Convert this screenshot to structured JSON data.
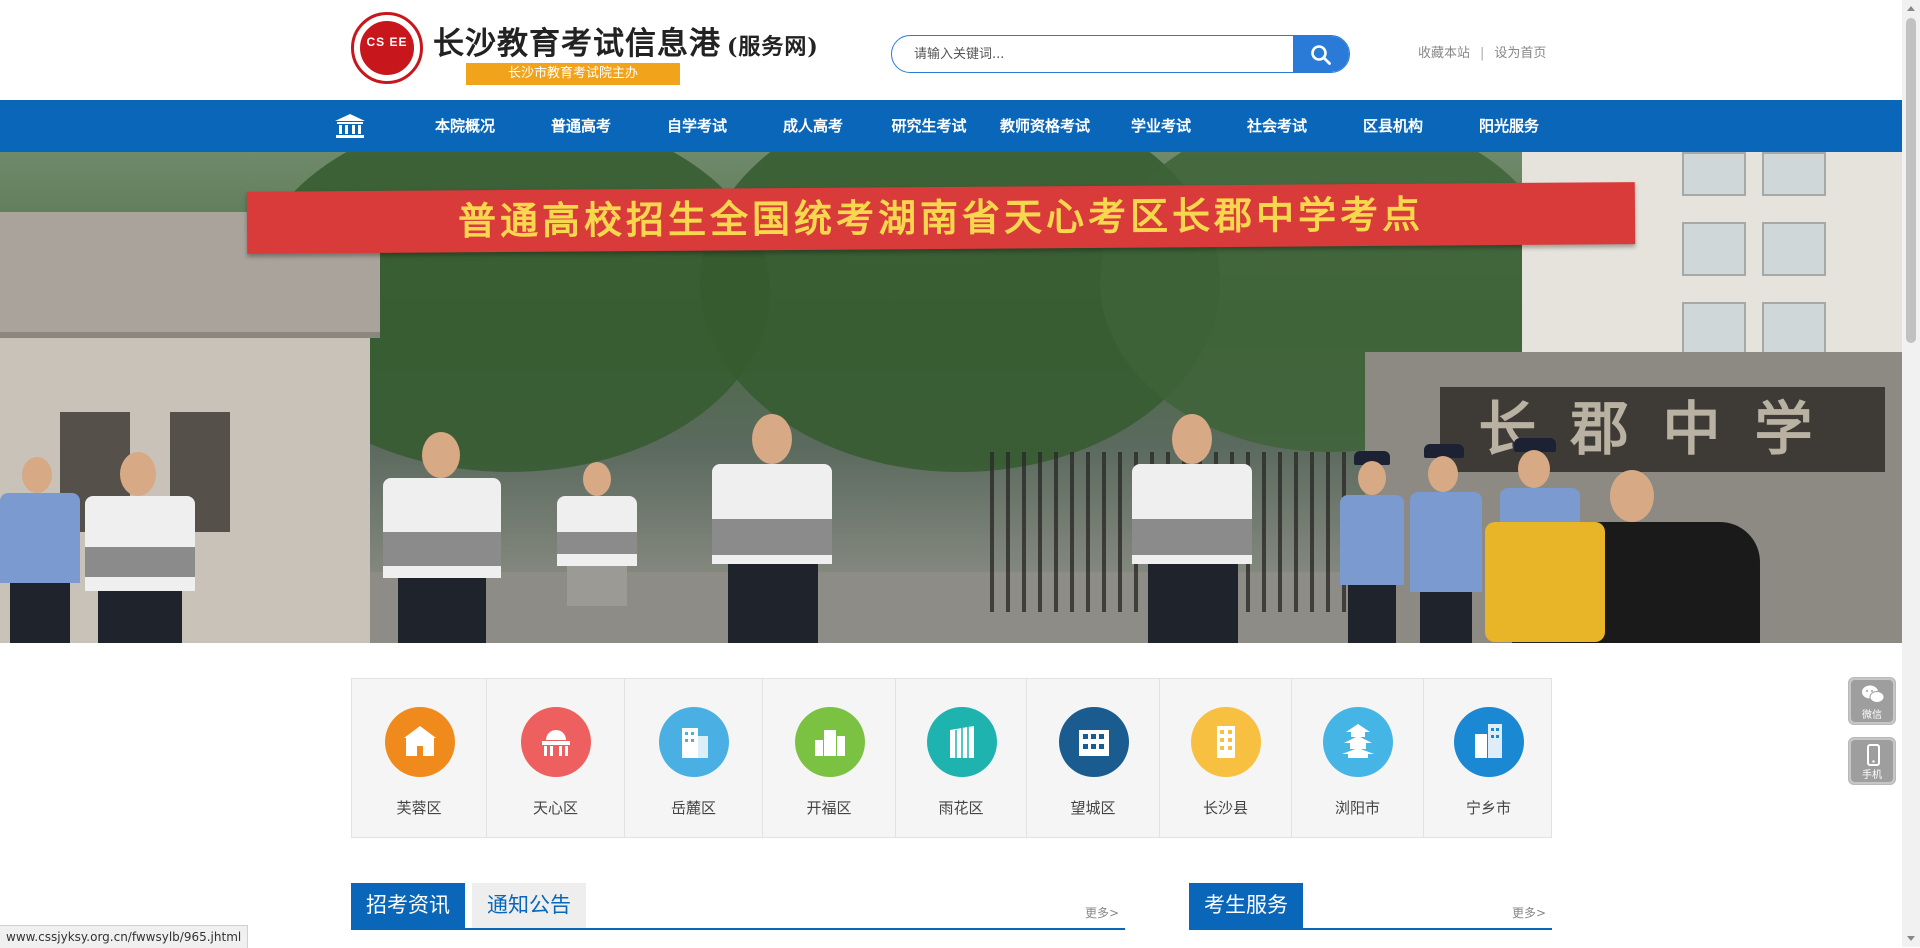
{
  "header": {
    "logo_monogram": "CS EE",
    "site_title": "长沙教育考试信息港",
    "site_title_suffix": "(服务网)",
    "sponsor": "长沙市教育考试院主办",
    "search": {
      "placeholder": "请输入关键词..."
    },
    "links": {
      "favorite": "收藏本站",
      "separator": "|",
      "homepage": "设为首页"
    }
  },
  "nav": {
    "items": [
      {
        "label": "本院概况"
      },
      {
        "label": "普通高考"
      },
      {
        "label": "自学考试"
      },
      {
        "label": "成人高考"
      },
      {
        "label": "研究生考试"
      },
      {
        "label": "教师资格考试"
      },
      {
        "label": "学业考试"
      },
      {
        "label": "社会考试"
      },
      {
        "label": "区县机构"
      },
      {
        "label": "阳光服务"
      }
    ]
  },
  "banner": {
    "banner_text": "普通高校招生全国统考湖南省天心考区长郡中学考点",
    "plaque_text": "长郡中学",
    "slide_count": 6,
    "active_slide": 5
  },
  "districts": [
    {
      "label": "芙蓉区",
      "color": "#f08a1c",
      "icon": "school-building-icon"
    },
    {
      "label": "天心区",
      "color": "#ee5f5f",
      "icon": "capitol-building-icon"
    },
    {
      "label": "岳麓区",
      "color": "#4ab0e4",
      "icon": "office-building-icon"
    },
    {
      "label": "开福区",
      "color": "#7cc242",
      "icon": "city-skyline-icon"
    },
    {
      "label": "雨花区",
      "color": "#1fb3b0",
      "icon": "glass-tower-icon"
    },
    {
      "label": "望城区",
      "color": "#1a5c8f",
      "icon": "apartment-block-icon"
    },
    {
      "label": "长沙县",
      "color": "#f8c040",
      "icon": "tower-building-icon"
    },
    {
      "label": "浏阳市",
      "color": "#45b5e6",
      "icon": "pagoda-icon"
    },
    {
      "label": "宁乡市",
      "color": "#1b88d3",
      "icon": "highrise-icon"
    }
  ],
  "news": {
    "tabs": [
      "招考资讯",
      "通知公告"
    ],
    "more": "更多>"
  },
  "service": {
    "title": "考生服务",
    "more": "更多>"
  },
  "side_buttons": [
    {
      "label": "微信",
      "icon": "wechat-icon"
    },
    {
      "label": "手机",
      "icon": "mobile-phone-icon"
    }
  ],
  "status_url": "www.cssjyksy.org.cn/fwwsylb/965.jhtml",
  "colors": {
    "primary": "#0966b9",
    "accent": "#f1a31c",
    "logo_red": "#c8161d"
  }
}
